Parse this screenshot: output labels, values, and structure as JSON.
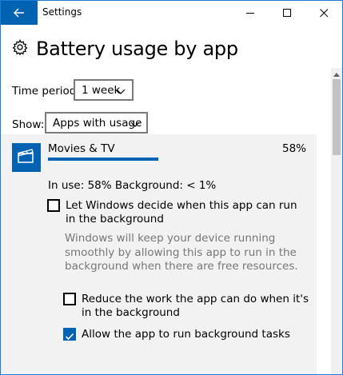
{
  "window": {
    "title": "Settings"
  },
  "titlebar": {
    "back_icon": "back-arrow-icon",
    "minimize_icon": "minimize-icon",
    "maximize_icon": "maximize-icon",
    "close_icon": "close-icon"
  },
  "page": {
    "title": "Battery usage by app",
    "title_icon": "gear-icon"
  },
  "filters": {
    "time_period": {
      "label": "Time period:",
      "value": "1 week"
    },
    "show": {
      "label": "Show:",
      "value": "Apps with usage"
    }
  },
  "app": {
    "name": "Movies & TV",
    "percent_label": "58%",
    "usage_fraction": 0.58,
    "icon": "movies-clapperboard-icon",
    "in_use_text": "In use: 58% Background: < 1%"
  },
  "options": {
    "let_windows_decide": {
      "label": "Let Windows decide when this app can run in the background",
      "checked": false,
      "description": "Windows will keep your device running smoothly by allowing this app to run in the background when there are free resources."
    },
    "reduce_work": {
      "label": "Reduce the work the app can do when it's in the background",
      "checked": false
    },
    "allow_background": {
      "label": "Allow the app to run background tasks",
      "checked": true
    }
  },
  "colors": {
    "accent": "#0063b1",
    "panel_bg": "#f2f2f2",
    "window_border": "#1f7ad4",
    "muted_text": "#777777"
  }
}
